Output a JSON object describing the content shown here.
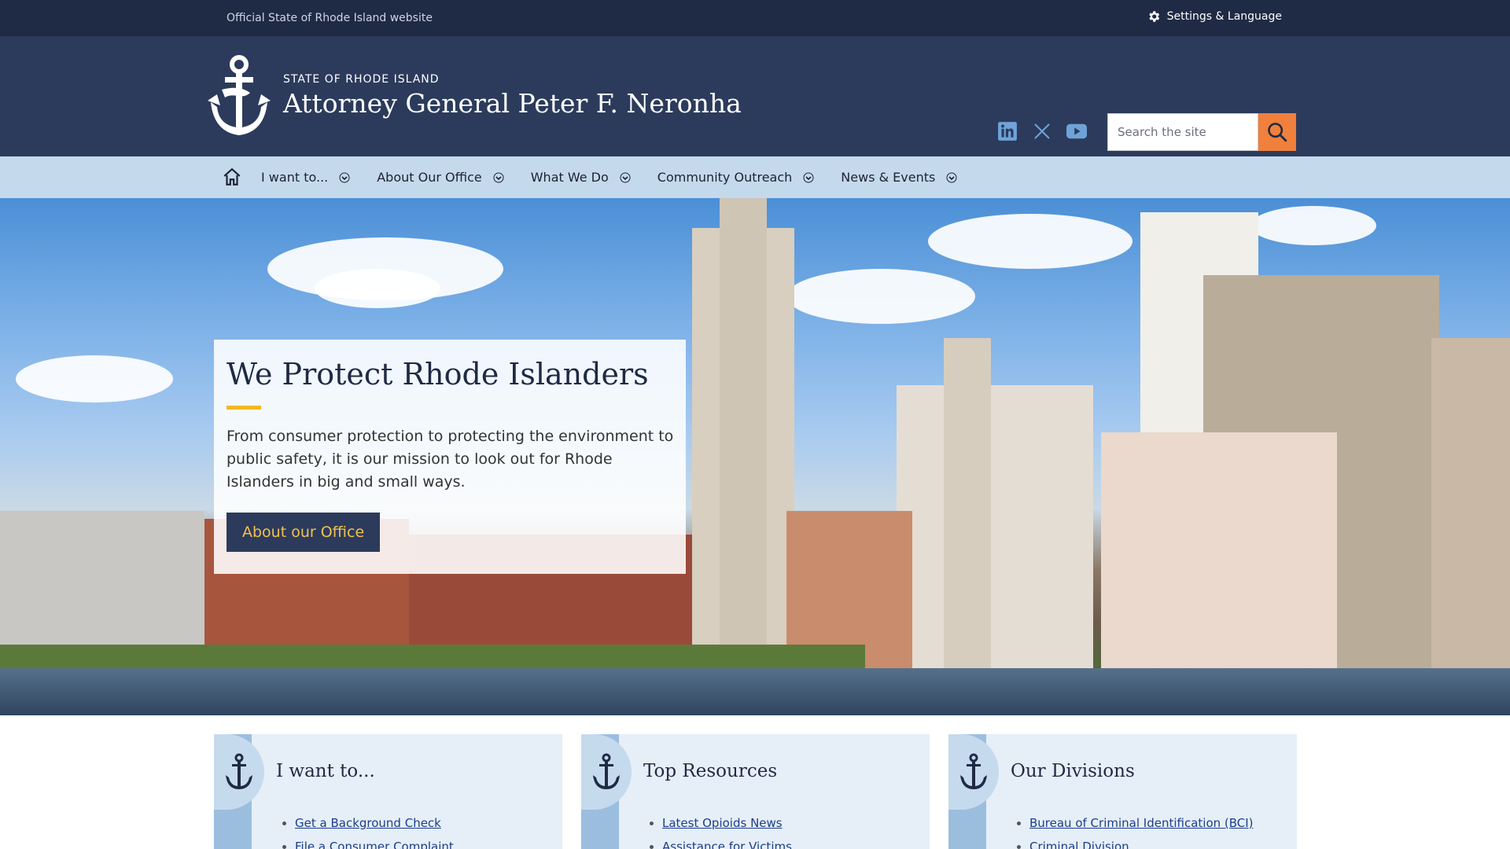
{
  "topbar": {
    "official_text": "Official State of Rhode Island website",
    "settings_label": "Settings & Language"
  },
  "header": {
    "subtitle": "STATE OF RHODE ISLAND",
    "title": "Attorney General Peter F. Neronha",
    "socials": [
      "linkedin-icon",
      "x-icon",
      "youtube-icon"
    ],
    "search_placeholder": "Search the site"
  },
  "nav": {
    "items": [
      {
        "label": "I want to..."
      },
      {
        "label": "About Our Office"
      },
      {
        "label": "What We Do"
      },
      {
        "label": "Community Outreach"
      },
      {
        "label": "News & Events"
      }
    ]
  },
  "hero": {
    "heading": "We Protect Rhode Islanders",
    "body": "From consumer protection to protecting the environment to public safety, it is our mission to look out for Rhode Islanders in big and small ways.",
    "cta_label": "About our Office"
  },
  "cards": [
    {
      "title": "I want to...",
      "links": [
        "Get a Background Check",
        "File a Consumer Complaint"
      ]
    },
    {
      "title": "Top Resources",
      "links": [
        "Latest Opioids News",
        "Assistance for Victims"
      ]
    },
    {
      "title": "Our Divisions",
      "links": [
        "Bureau of Criminal Identification (BCI)",
        "Criminal Division"
      ]
    }
  ],
  "colors": {
    "topbar": "#1f2a44",
    "header": "#2c3b5c",
    "nav": "#c5d9ec",
    "accent_orange": "#f0803c",
    "accent_yellow": "#f2b723",
    "link": "#1b3d8a"
  }
}
